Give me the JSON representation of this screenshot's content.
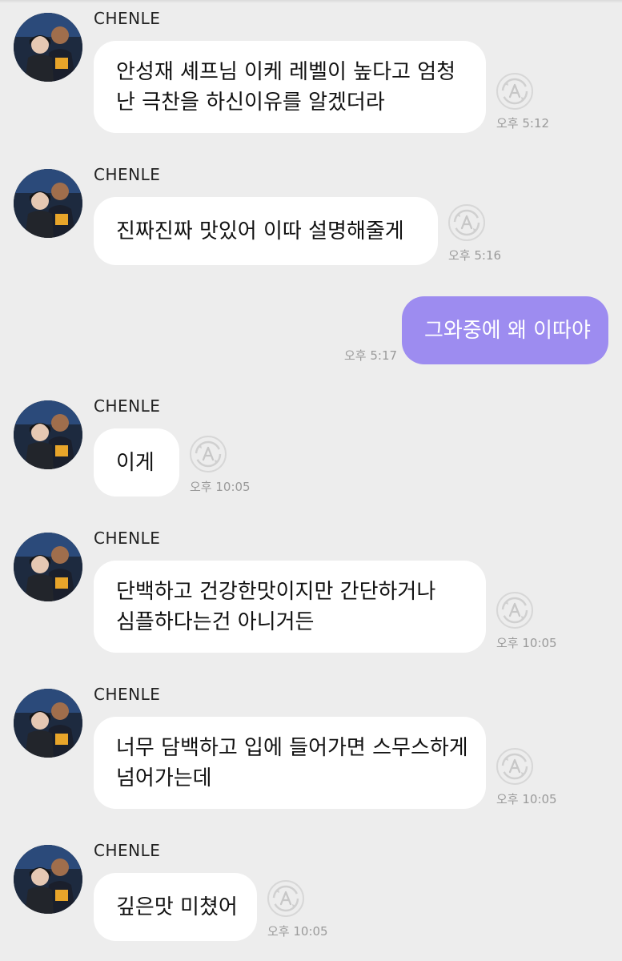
{
  "colors": {
    "background": "#ededed",
    "incoming_bubble": "#ffffff",
    "outgoing_bubble": "#9d8cf0",
    "timestamp": "#9a9a9a"
  },
  "icons": {
    "avatar": "profile-photo",
    "translate": "ai-translate-icon"
  },
  "messages": [
    {
      "sender": "CHENLE",
      "direction": "incoming",
      "lines": [
        "안성재 셰프님 이케 레벨이 높다고 엄청",
        "난 극찬을 하신이유를 알겠더라"
      ],
      "time": "오후 5:12"
    },
    {
      "sender": "CHENLE",
      "direction": "incoming",
      "lines": [
        "진짜진짜 맛있어 이따 설명해줄게"
      ],
      "time": "오후 5:16"
    },
    {
      "direction": "outgoing",
      "lines": [
        "그와중에 왜 이따야"
      ],
      "time": "오후 5:17"
    },
    {
      "sender": "CHENLE",
      "direction": "incoming",
      "lines": [
        "이게"
      ],
      "time": "오후 10:05"
    },
    {
      "sender": "CHENLE",
      "direction": "incoming",
      "lines": [
        "단백하고 건강한맛이지만 간단하거나",
        "심플하다는건 아니거든"
      ],
      "time": "오후 10:05"
    },
    {
      "sender": "CHENLE",
      "direction": "incoming",
      "lines": [
        "너무 담백하고 입에 들어가면 스무스하게",
        "넘어가는데"
      ],
      "time": "오후 10:05"
    },
    {
      "sender": "CHENLE",
      "direction": "incoming",
      "lines": [
        "깊은맛 미쳤어"
      ],
      "time": "오후 10:05"
    }
  ]
}
